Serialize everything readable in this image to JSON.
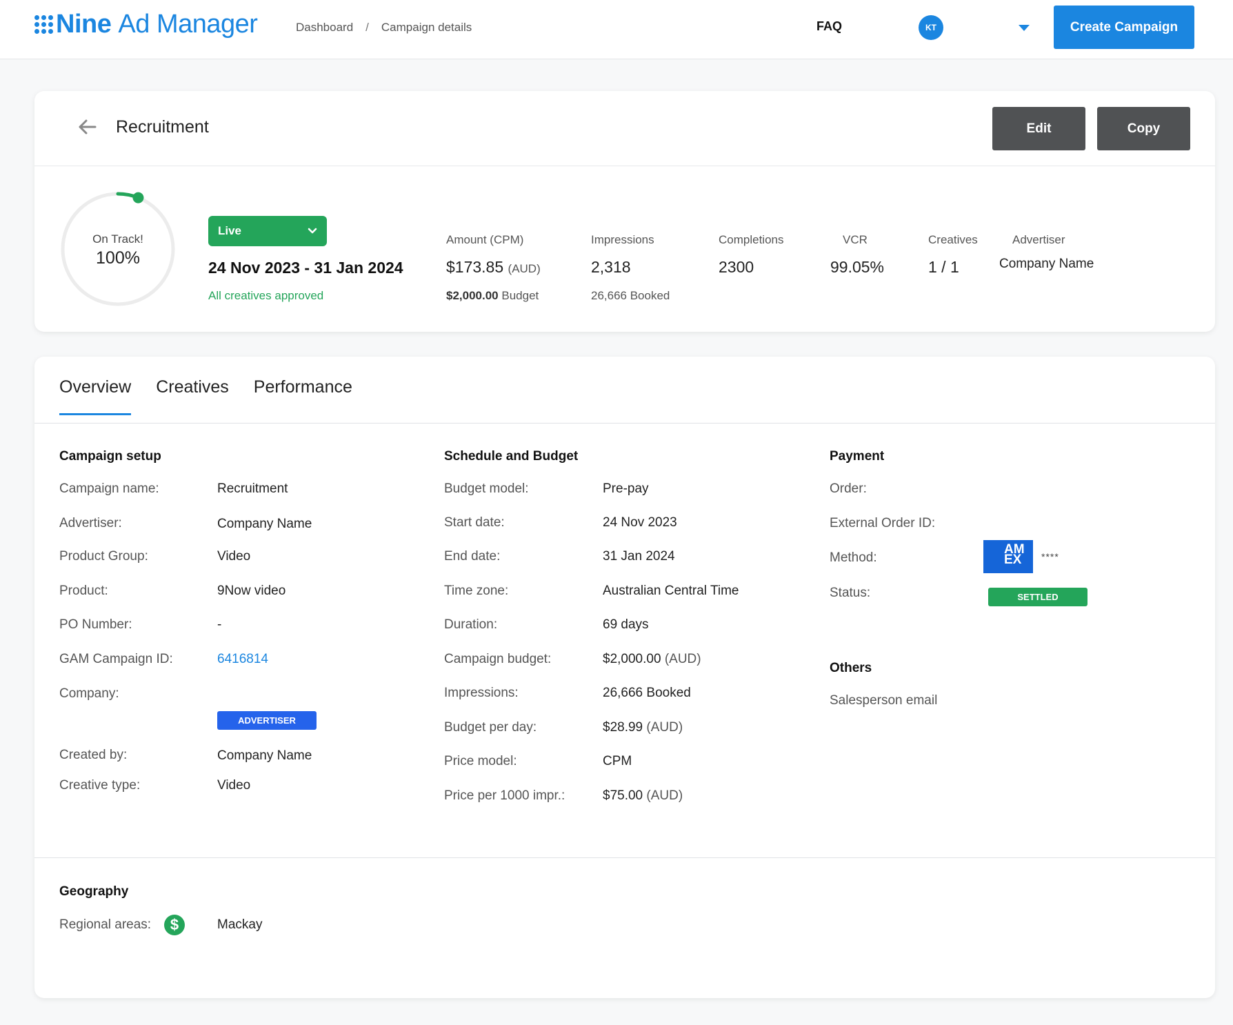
{
  "header": {
    "brand_bold": "Nine",
    "brand_rest": "Ad Manager",
    "breadcrumb": [
      "Dashboard",
      "Campaign details"
    ],
    "breadcrumb_sep": "/",
    "faq": "FAQ",
    "avatar_initials": "KT",
    "create_label": "Create Campaign"
  },
  "summary": {
    "title": "Recruitment",
    "edit_label": "Edit",
    "copy_label": "Copy",
    "progress_label": "On Track!",
    "progress_value": "100%",
    "progress_fraction": 0.06,
    "status": "Live",
    "date_range": "24 Nov 2023 - 31 Jan 2024",
    "approval": "All creatives approved",
    "stats": {
      "amount_label": "Amount (CPM)",
      "amount_value": "$173.85",
      "amount_unit": "(AUD)",
      "budget_value": "$2,000.00",
      "budget_label": "Budget",
      "impressions_label": "Impressions",
      "impressions_value": "2,318",
      "booked_value": "26,666 Booked",
      "completions_label": "Completions",
      "completions_value": "2300",
      "vcr_label": "VCR",
      "vcr_value": "99.05%",
      "creatives_label": "Creatives",
      "creatives_value": "1 / 1",
      "advertiser_label": "Advertiser",
      "advertiser_value": "Company Name"
    }
  },
  "tabs": [
    "Overview",
    "Creatives",
    "Performance"
  ],
  "setup": {
    "title": "Campaign setup",
    "rows": [
      {
        "label": "Campaign name:",
        "value": "Recruitment"
      },
      {
        "label": "Advertiser:",
        "value": "Company Name"
      },
      {
        "label": "Product Group:",
        "value": "Video"
      },
      {
        "label": "Product:",
        "value": "9Now video"
      },
      {
        "label": "PO Number:",
        "value": "-"
      },
      {
        "label": "GAM Campaign ID:",
        "value": "6416814"
      },
      {
        "label": "Company:",
        "value": ""
      },
      {
        "label": "Created by:",
        "value": "Company Name"
      },
      {
        "label": "Creative type:",
        "value": "Video"
      }
    ],
    "company_badge": "ADVERTISER"
  },
  "schedule": {
    "title": "Schedule and Budget",
    "rows": [
      {
        "label": "Budget model:",
        "value": "Pre-pay",
        "unit": ""
      },
      {
        "label": "Start date:",
        "value": "24 Nov 2023",
        "unit": ""
      },
      {
        "label": "End date:",
        "value": "31 Jan 2024",
        "unit": ""
      },
      {
        "label": "Time zone:",
        "value": "Australian Central Time",
        "unit": ""
      },
      {
        "label": "Duration:",
        "value": "69 days",
        "unit": ""
      },
      {
        "label": "Campaign budget:",
        "value": "$2,000.00",
        "unit": "(AUD)"
      },
      {
        "label": "Impressions:",
        "value": "26,666 Booked",
        "unit": ""
      },
      {
        "label": "Budget per day:",
        "value": "$28.99",
        "unit": "(AUD)"
      },
      {
        "label": "Price model:",
        "value": "CPM",
        "unit": ""
      },
      {
        "label": "Price per 1000 impr.:",
        "value": "$75.00",
        "unit": "(AUD)"
      }
    ]
  },
  "payment": {
    "title": "Payment",
    "order_label": "Order:",
    "external_label": "External Order ID:",
    "method_label": "Method:",
    "card_brand_line1": "AM",
    "card_brand_line2": "EX",
    "card_masked": "****",
    "status_label": "Status:",
    "status_value": "SETTLED"
  },
  "others": {
    "title": "Others",
    "salesperson_label": "Salesperson email"
  },
  "geography": {
    "title": "Geography",
    "regional_label": "Regional areas:",
    "regional_value": "Mackay"
  },
  "colors": {
    "accent": "#1b86e0",
    "success": "#24a55a",
    "badge_blue": "#2563eb",
    "dark_button": "#505254"
  }
}
